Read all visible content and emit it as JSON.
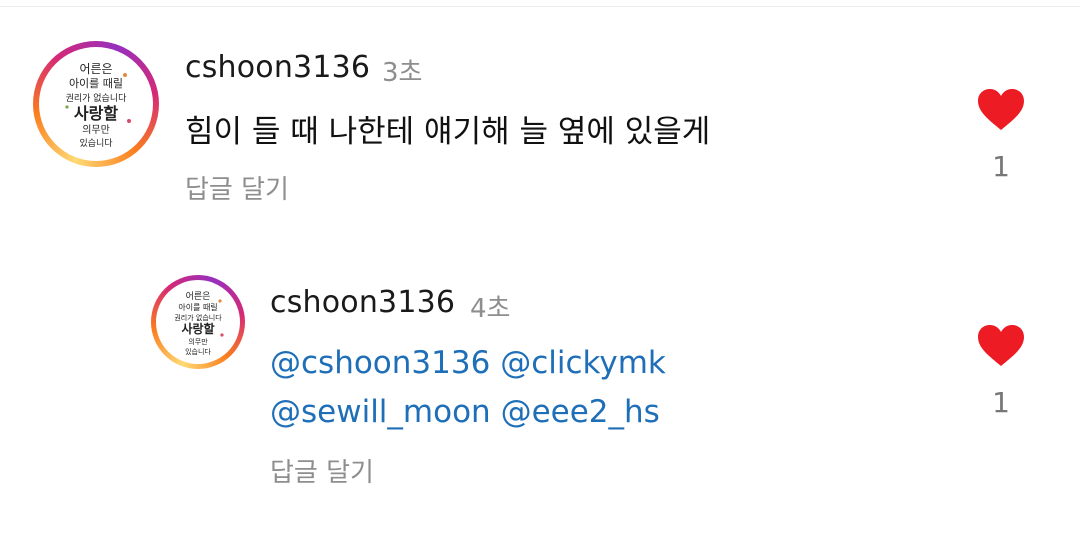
{
  "comments": [
    {
      "username": "cshoon3136",
      "time": "3초",
      "text": "힘이 들 때 나한테 얘기해 늘 옆에 있을게",
      "reply_label": "답글 달기",
      "likes": "1",
      "avatar_icon": "calligraphy-avatar",
      "like_color": "#ed1c24"
    }
  ],
  "replies": [
    {
      "username": "cshoon3136",
      "time": "4초",
      "mentions": [
        [
          "@cshoon3136",
          "@clickymk"
        ],
        [
          "@sewill_moon",
          "@eee2_hs"
        ]
      ],
      "reply_label": "답글 달기",
      "likes": "1",
      "avatar_icon": "calligraphy-avatar",
      "like_color": "#ed1c24",
      "mention_color": "#1f6fb8"
    }
  ],
  "avatar_text": {
    "line1": "어른은",
    "line2": "아이를 때릴",
    "line3": "권리가 없습니다",
    "line4": "사랑할",
    "line5": "의무만",
    "line6": "있습니다"
  }
}
